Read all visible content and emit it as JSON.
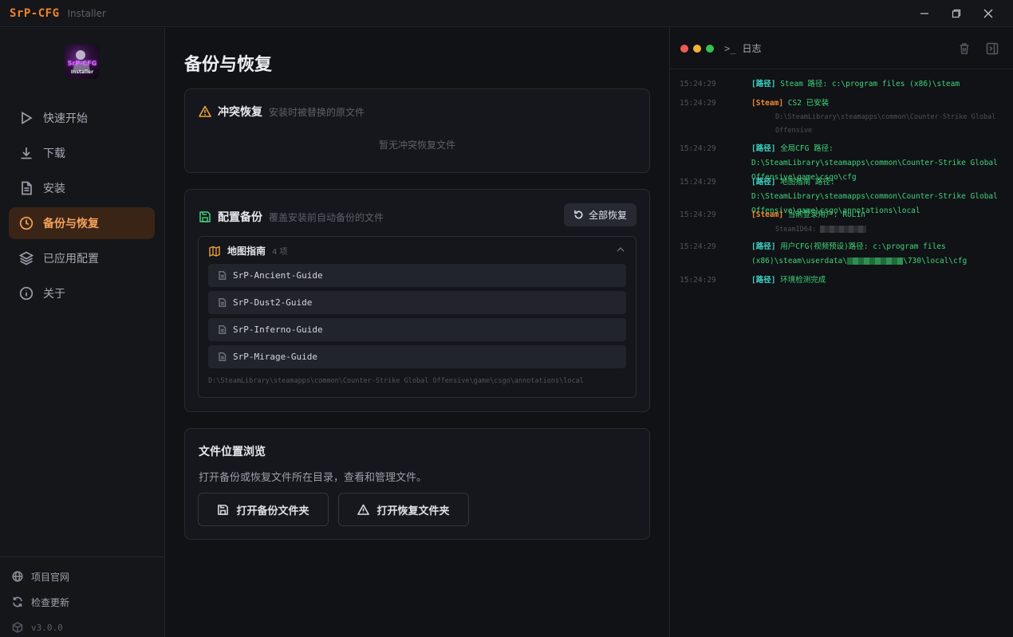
{
  "window": {
    "title": "SrP-CFG",
    "subtitle": "Installer"
  },
  "logo": {
    "text": "SrP-CFG",
    "subtext": "Installer"
  },
  "sidebar": {
    "items": [
      {
        "label": "快速开始",
        "icon": "play-icon"
      },
      {
        "label": "下载",
        "icon": "download-icon"
      },
      {
        "label": "安装",
        "icon": "file-text-icon"
      },
      {
        "label": "备份与恢复",
        "icon": "clock-icon",
        "active": true
      },
      {
        "label": "已应用配置",
        "icon": "layers-icon"
      },
      {
        "label": "关于",
        "icon": "info-icon"
      }
    ],
    "bottom": {
      "website": "项目官网",
      "update": "检查更新",
      "version": "v3.0.0"
    }
  },
  "main": {
    "title": "备份与恢复",
    "conflict": {
      "title": "冲突恢复",
      "subtitle": "安装时被替换的原文件",
      "empty": "暂无冲突恢复文件"
    },
    "backup": {
      "title": "配置备份",
      "subtitle": "覆盖安装前自动备份的文件",
      "restore_all": "全部恢复",
      "group": {
        "title": "地图指南",
        "count": "4 项",
        "files": [
          "SrP-Ancient-Guide",
          "SrP-Dust2-Guide",
          "SrP-Inferno-Guide",
          "SrP-Mirage-Guide"
        ],
        "path": "D:\\SteamLibrary\\steamapps\\common\\Counter-Strike Global Offensive\\game\\csgo\\annotations\\local"
      }
    },
    "browse": {
      "title": "文件位置浏览",
      "desc": "打开备份或恢复文件所在目录，查看和管理文件。",
      "open_backup": "打开备份文件夹",
      "open_restore": "打开恢复文件夹"
    }
  },
  "log": {
    "title": "日志",
    "prompt": ">_",
    "colors": {
      "path": "#3dd6c6",
      "steam": "#f08a33",
      "text": "#3fd47c"
    },
    "lines": [
      {
        "time": "15:24:29",
        "tag": "[路径]",
        "text": "Steam 路径: c:\\program files (x86)\\steam"
      },
      {
        "time": "15:24:29",
        "tag": "[Steam]",
        "text": "CS2 已安装",
        "sub": "D:\\SteamLibrary\\steamapps\\common\\Counter-Strike Global Offensive"
      },
      {
        "time": "15:24:29",
        "tag": "[路径]",
        "text": "全局CFG 路径: D:\\SteamLibrary\\steamapps\\common\\Counter-Strike Global Offensive\\game\\csgo\\cfg"
      },
      {
        "time": "15:24:29",
        "tag": "[路径]",
        "text": "地图指南 路径: D:\\SteamLibrary\\steamapps\\common\\Counter-Strike Global Offensive\\game\\csgo\\annotations\\local"
      },
      {
        "time": "15:24:29",
        "tag": "[Steam]",
        "text": "当前登录用户: RoL1n",
        "sub": "SteamID64:"
      },
      {
        "time": "15:24:29",
        "tag": "[路径]",
        "text_a": "用户CFG(视频预设)路径: c:\\program files (x86)\\steam\\userdata\\",
        "text_b": "\\730\\local\\cfg"
      },
      {
        "time": "15:24:29",
        "tag": "[路径]",
        "text": "环境检测完成"
      }
    ]
  }
}
